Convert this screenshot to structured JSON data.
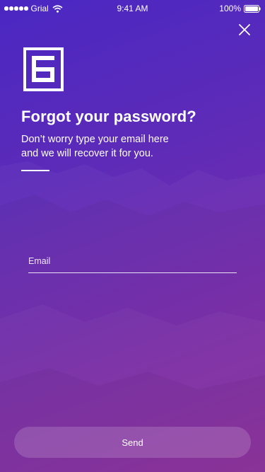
{
  "status_bar": {
    "carrier": "Grial",
    "time": "9:41 AM",
    "battery": "100%",
    "icons": [
      "signal-dots-icon",
      "wifi-icon",
      "battery-icon"
    ]
  },
  "close_icon": "close-icon",
  "logo_icon": "grial-logo-icon",
  "title": "Forgot your password?",
  "subtitle_lines": [
    "Don’t worry type your email here",
    "and we will recover it for you."
  ],
  "form": {
    "email_placeholder": "Email",
    "email_value": ""
  },
  "send_label": "Send",
  "colors": {
    "gradient_start": "#4a27c3",
    "gradient_end": "#8f2a9e",
    "text": "#ffffff"
  }
}
